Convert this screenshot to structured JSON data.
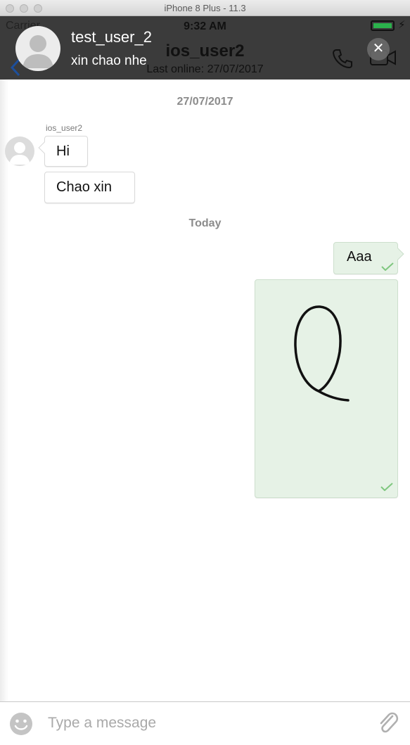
{
  "simulator": {
    "title": "iPhone 8 Plus - 11.3"
  },
  "status_bar": {
    "carrier": "Carrier",
    "time": "9:32 AM"
  },
  "header": {
    "chat_name": "ios_user2",
    "last_online": "Last online: 27/07/2017",
    "back_icon": "chevron-left-icon",
    "call_icon": "phone-icon",
    "video_icon": "video-camera-icon"
  },
  "notification": {
    "title": "test_user_2",
    "body": "xin chao nhe",
    "close_icon": "close-icon"
  },
  "messages": {
    "date_1": "27/07/2017",
    "sender": "ios_user2",
    "incoming_1": "Hi",
    "incoming_2": "Chao xin",
    "date_2": "Today",
    "outgoing_1": "Aaa",
    "outgoing_2_type": "handwriting-sketch"
  },
  "composer": {
    "placeholder": "Type a message",
    "emoji_icon": "emoji-icon",
    "attach_icon": "paperclip-icon"
  },
  "colors": {
    "outgoing_bubble": "#e6f2e6",
    "check": "#7fc77f",
    "header_overlay": "#3b3b3b"
  }
}
